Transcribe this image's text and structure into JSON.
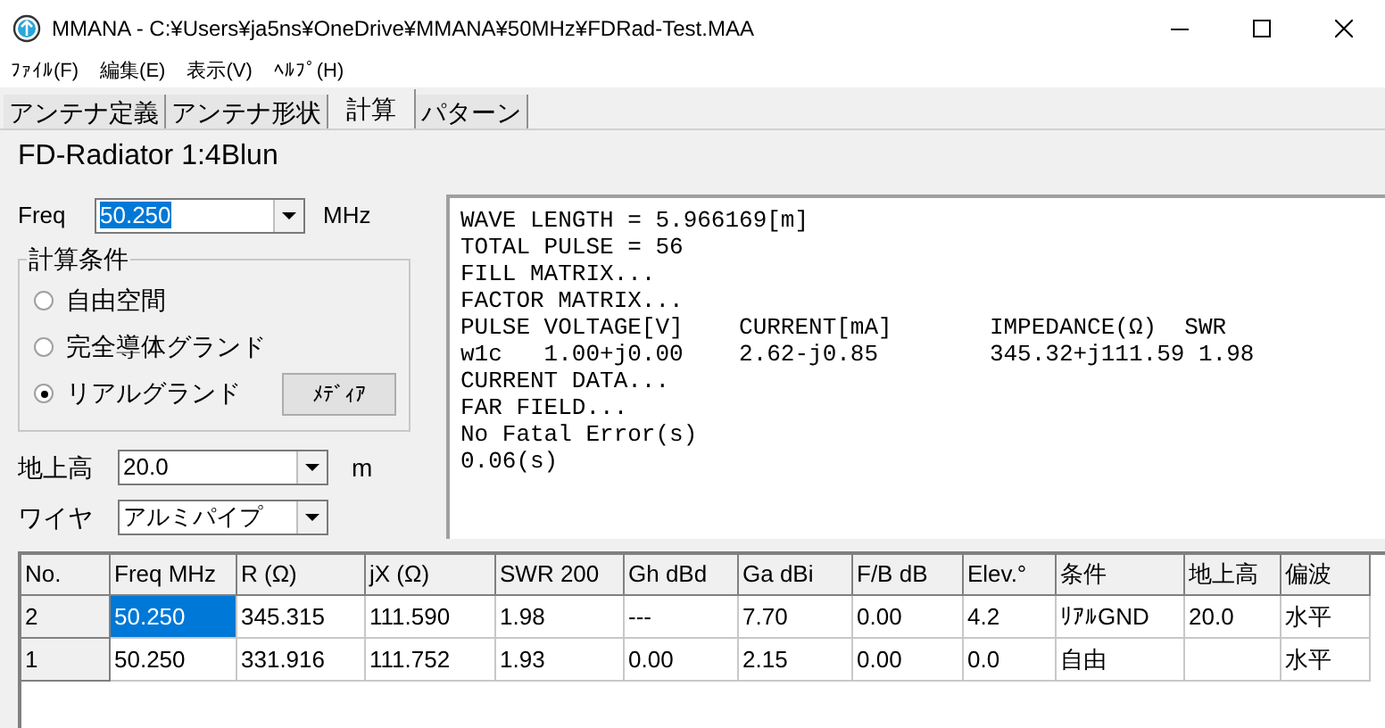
{
  "window": {
    "title": "MMANA - C:¥Users¥ja5ns¥OneDrive¥MMANA¥50MHz¥FDRad-Test.MAA"
  },
  "menu": [
    "ﾌｧｲﾙ(F)",
    "編集(E)",
    "表示(V)",
    "ﾍﾙﾌﾟ(H)"
  ],
  "tabs": [
    {
      "label": "アンテナ定義",
      "selected": false
    },
    {
      "label": "アンテナ形状",
      "selected": false
    },
    {
      "label": "計算",
      "selected": true
    },
    {
      "label": "パターン",
      "selected": false
    }
  ],
  "antenna_name": "FD-Radiator 1:4Blun",
  "freq": {
    "label": "Freq",
    "value": "50.250",
    "unit": "MHz"
  },
  "conditions": {
    "title": "計算条件",
    "options": [
      {
        "label": "自由空間",
        "selected": false
      },
      {
        "label": "完全導体グランド",
        "selected": false
      },
      {
        "label": "リアルグランド",
        "selected": true
      }
    ],
    "media_button": "ﾒﾃﾞｨｱ"
  },
  "height": {
    "label": "地上高",
    "value": "20.0",
    "unit": "m"
  },
  "wire": {
    "label": "ワイヤ",
    "value": "アルミパイプ"
  },
  "output": [
    "WAVE LENGTH = 5.966169[m]",
    "TOTAL PULSE = 56",
    "FILL MATRIX...",
    "FACTOR MATRIX...",
    "PULSE VOLTAGE[V]    CURRENT[mA]       IMPEDANCE(Ω)  SWR",
    "w1c   1.00+j0.00    2.62-j0.85        345.32+j111.59 1.98",
    "CURRENT DATA...",
    "FAR FIELD...",
    "No Fatal Error(s)",
    "0.06(s)"
  ],
  "table": {
    "columns": [
      "No.",
      "Freq MHz",
      "R (Ω)",
      "jX (Ω)",
      "SWR 200",
      "Gh dBd",
      "Ga dBi",
      "F/B dB",
      "Elev.°",
      "条件",
      "地上高",
      "偏波"
    ],
    "rows": [
      {
        "selected": true,
        "cells": [
          "2",
          "50.250",
          "345.315",
          "111.590",
          "1.98",
          "---",
          "7.70",
          "0.00",
          "4.2",
          "ﾘｱﾙGND",
          "20.0",
          "水平"
        ]
      },
      {
        "selected": false,
        "cells": [
          "1",
          "50.250",
          "331.916",
          "111.752",
          "1.93",
          "0.00",
          "2.15",
          "0.00",
          "0.0",
          "自由",
          "",
          "水平"
        ]
      }
    ]
  }
}
